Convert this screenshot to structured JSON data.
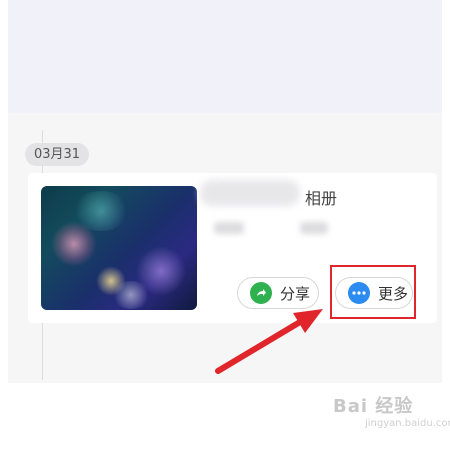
{
  "timeline": {
    "date_label": "03月31"
  },
  "album_card": {
    "title_visible_suffix": "相册",
    "share_label": "分享",
    "more_label": "更多",
    "share_icon": "share-arrow-icon",
    "more_icon": "more-dots-icon"
  },
  "annotation": {
    "highlight_color": "#e0262b",
    "arrow_color": "#e0262b"
  },
  "watermark": {
    "brand": "Bai 经验",
    "url": "jingyan.baidu.com"
  },
  "colors": {
    "share_icon_bg": "#2fb14f",
    "more_icon_bg": "#2c8bf0"
  }
}
